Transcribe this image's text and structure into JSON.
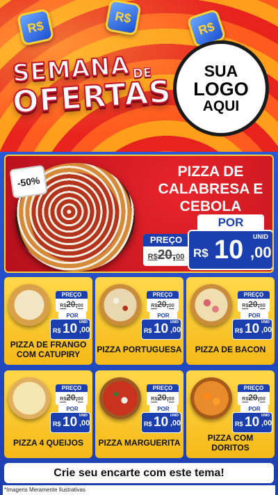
{
  "header": {
    "currency_icon_text": "R$",
    "title_line1": "SEMANA",
    "title_de": "DE",
    "title_line2": "OFERTAS",
    "logo": {
      "line1": "SUA",
      "line2": "LOGO",
      "line3": "AQUI"
    }
  },
  "featured": {
    "discount": "-50%",
    "name": "PIZZA DE CALABRESA E CEBOLA",
    "preco_label": "PREÇO",
    "old_price_cur": "R$",
    "old_price": "20,",
    "old_price_dec": "00",
    "por_label": "POR",
    "currency": "R$",
    "price_int": "10",
    "price_dec": ",00",
    "unit": "UNID"
  },
  "products": [
    {
      "name": "PIZZA DE FRANGO COM CATUPIRY",
      "preco_label": "PREÇO",
      "old_cur": "R$",
      "old_price": "20,",
      "old_dec": "00",
      "por_label": "POR",
      "currency": "R$",
      "price_int": "10",
      "price_dec": ",00",
      "unit": "UNID",
      "icon": "pizza-frango-icon"
    },
    {
      "name": "PIZZA PORTUGUESA",
      "preco_label": "PREÇO",
      "old_cur": "R$",
      "old_price": "20,",
      "old_dec": "00",
      "por_label": "POR",
      "currency": "R$",
      "price_int": "10",
      "price_dec": ",00",
      "unit": "UNID",
      "icon": "pizza-portuguesa-icon"
    },
    {
      "name": "PIZZA DE BACON",
      "preco_label": "PREÇO",
      "old_cur": "R$",
      "old_price": "20,",
      "old_dec": "00",
      "por_label": "POR",
      "currency": "R$",
      "price_int": "10",
      "price_dec": ",00",
      "unit": "UNID",
      "icon": "pizza-bacon-icon"
    },
    {
      "name": "PIZZA 4 QUEIJOS",
      "preco_label": "PREÇO",
      "old_cur": "R$",
      "old_price": "20,",
      "old_dec": "00",
      "por_label": "POR",
      "currency": "R$",
      "price_int": "10",
      "price_dec": ",00",
      "unit": "UNID",
      "icon": "pizza-4queijos-icon"
    },
    {
      "name": "PIZZA MARGUERITA",
      "preco_label": "PREÇO",
      "old_cur": "R$",
      "old_price": "20,",
      "old_dec": "00",
      "por_label": "POR",
      "currency": "R$",
      "price_int": "10",
      "price_dec": ",00",
      "unit": "UNID",
      "icon": "pizza-marguerita-icon"
    },
    {
      "name": "PIZZA COM DORITOS",
      "preco_label": "PREÇO",
      "old_cur": "R$",
      "old_price": "20,",
      "old_dec": "00",
      "por_label": "POR",
      "currency": "R$",
      "price_int": "10",
      "price_dec": ",00",
      "unit": "UNID",
      "icon": "pizza-doritos-icon"
    }
  ],
  "cta": "Crie seu encarte com este tema!",
  "footnote": "*Imagens Meramente Ilustrativas",
  "colors": {
    "brand_blue": "#1c3fb0",
    "brand_red": "#c0152a",
    "card_yellow": "#ffd84a"
  }
}
